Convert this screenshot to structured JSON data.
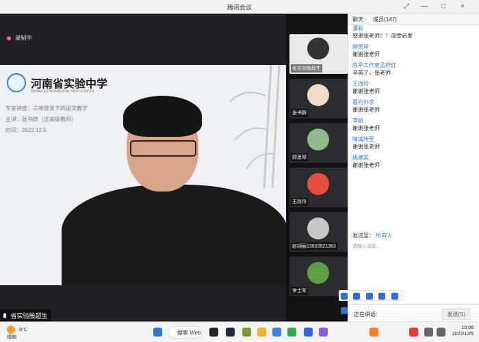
{
  "app": {
    "title": "腾讯会议"
  },
  "recording": {
    "label": "录制中"
  },
  "video": {
    "school_name": "河南省实验中学",
    "school_en": "HENAN EXPERIMENTAL HIGH SCHOOL",
    "lines": [
      "专家讲座：三新背景下的语文教学",
      "主讲：张书群（正高级教师）",
      "时间：2022.12.5"
    ],
    "speaker_label": "省实验殷超生"
  },
  "participants": [
    {
      "name": "省实验殷超生"
    },
    {
      "name": "张书群"
    },
    {
      "name": "顾思琴"
    },
    {
      "name": "王改玲"
    },
    {
      "name": "赵翊丽13633921363"
    },
    {
      "name": "李士军"
    }
  ],
  "chat": {
    "tabs": [
      "聊天",
      "成员(147)"
    ],
    "messages": [
      {
        "name": "潘聪",
        "text": "感谢张老师！！深受启发"
      },
      {
        "name": "顾思琴",
        "text": "谢谢张老师"
      },
      {
        "name": "陈平工作室孟祥红",
        "text": "辛苦了，张老师"
      },
      {
        "name": "王改玲",
        "text": "谢谢张老师"
      },
      {
        "name": "葛向外求",
        "text": "谢谢张老师"
      },
      {
        "name": "李娟",
        "text": "谢谢张老师"
      },
      {
        "name": "晴诚所至",
        "text": "谢谢张老师"
      },
      {
        "name": "姚建英",
        "text": "谢谢张老师"
      }
    ],
    "send_to": "发送至：",
    "recipient": "所有人",
    "input_placeholder": "请输入消息...",
    "speaking": "正在讲话:",
    "send_button": "发送(S)"
  },
  "taskbar": {
    "temperature": "9°C",
    "weather": "晴朗",
    "search_label": "搜索 Web",
    "time": "16:06",
    "date": "2022/12/5"
  }
}
